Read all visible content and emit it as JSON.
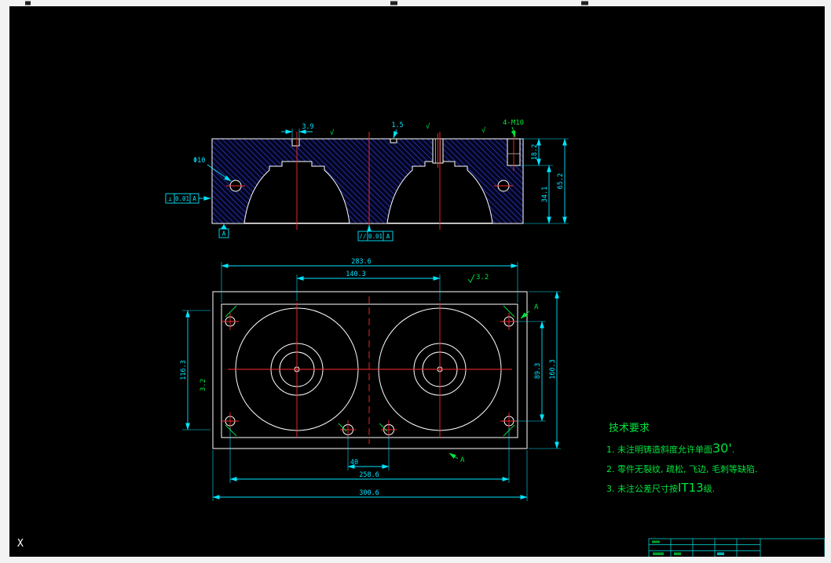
{
  "canvas": {
    "cursor_label": "X"
  },
  "colors": {
    "background": "#000000",
    "frame": "#f2f2f2",
    "outline": "#ffffff",
    "dimension": "#00e5ff",
    "centerline": "#ff2a2a",
    "hatch": "#2c42d8",
    "annotation_green": "#00e53c"
  },
  "section_view": {
    "dims": {
      "notch_width": "3.9",
      "step": "1.5",
      "counterbore_depth": "18.2",
      "cavity_depth": "34.1",
      "total_height": "65.2"
    },
    "labels": {
      "tapped_holes": "4-M10",
      "dowel_hole": "Φ10",
      "finish_mark": "√"
    },
    "fcf_perpendicularity": {
      "symbol": "⊥",
      "tolerance": "0.01",
      "datum": "A"
    },
    "fcf_parallelism": {
      "symbol": "//",
      "tolerance": "0.01",
      "datum": "A"
    },
    "datum": "A"
  },
  "plan_view": {
    "dims": {
      "inner_width": "283.6",
      "bore_spacing": "140.3",
      "inner_height": "116.3",
      "outer_height": "160.3",
      "hole_row_spacing": "89.3",
      "small_hole_spacing": "40",
      "bolt_span": "258.6",
      "outer_width": "300.6"
    },
    "labels": {
      "section_mark": "A",
      "roughness_top": "3.2",
      "roughness_left": "3.2"
    }
  },
  "tech_requirements": {
    "title": "技术要求",
    "items": [
      {
        "prefix": "1. 未注明铸造斜度允许单面",
        "emph": "30'",
        "suffix": "."
      },
      {
        "prefix": "2. 零件无裂纹, 疏松, 飞边, 毛刺等缺陷.",
        "emph": "",
        "suffix": ""
      },
      {
        "prefix": "3. 未注公差尺寸按",
        "emph": "IT13",
        "suffix": "级."
      }
    ]
  }
}
